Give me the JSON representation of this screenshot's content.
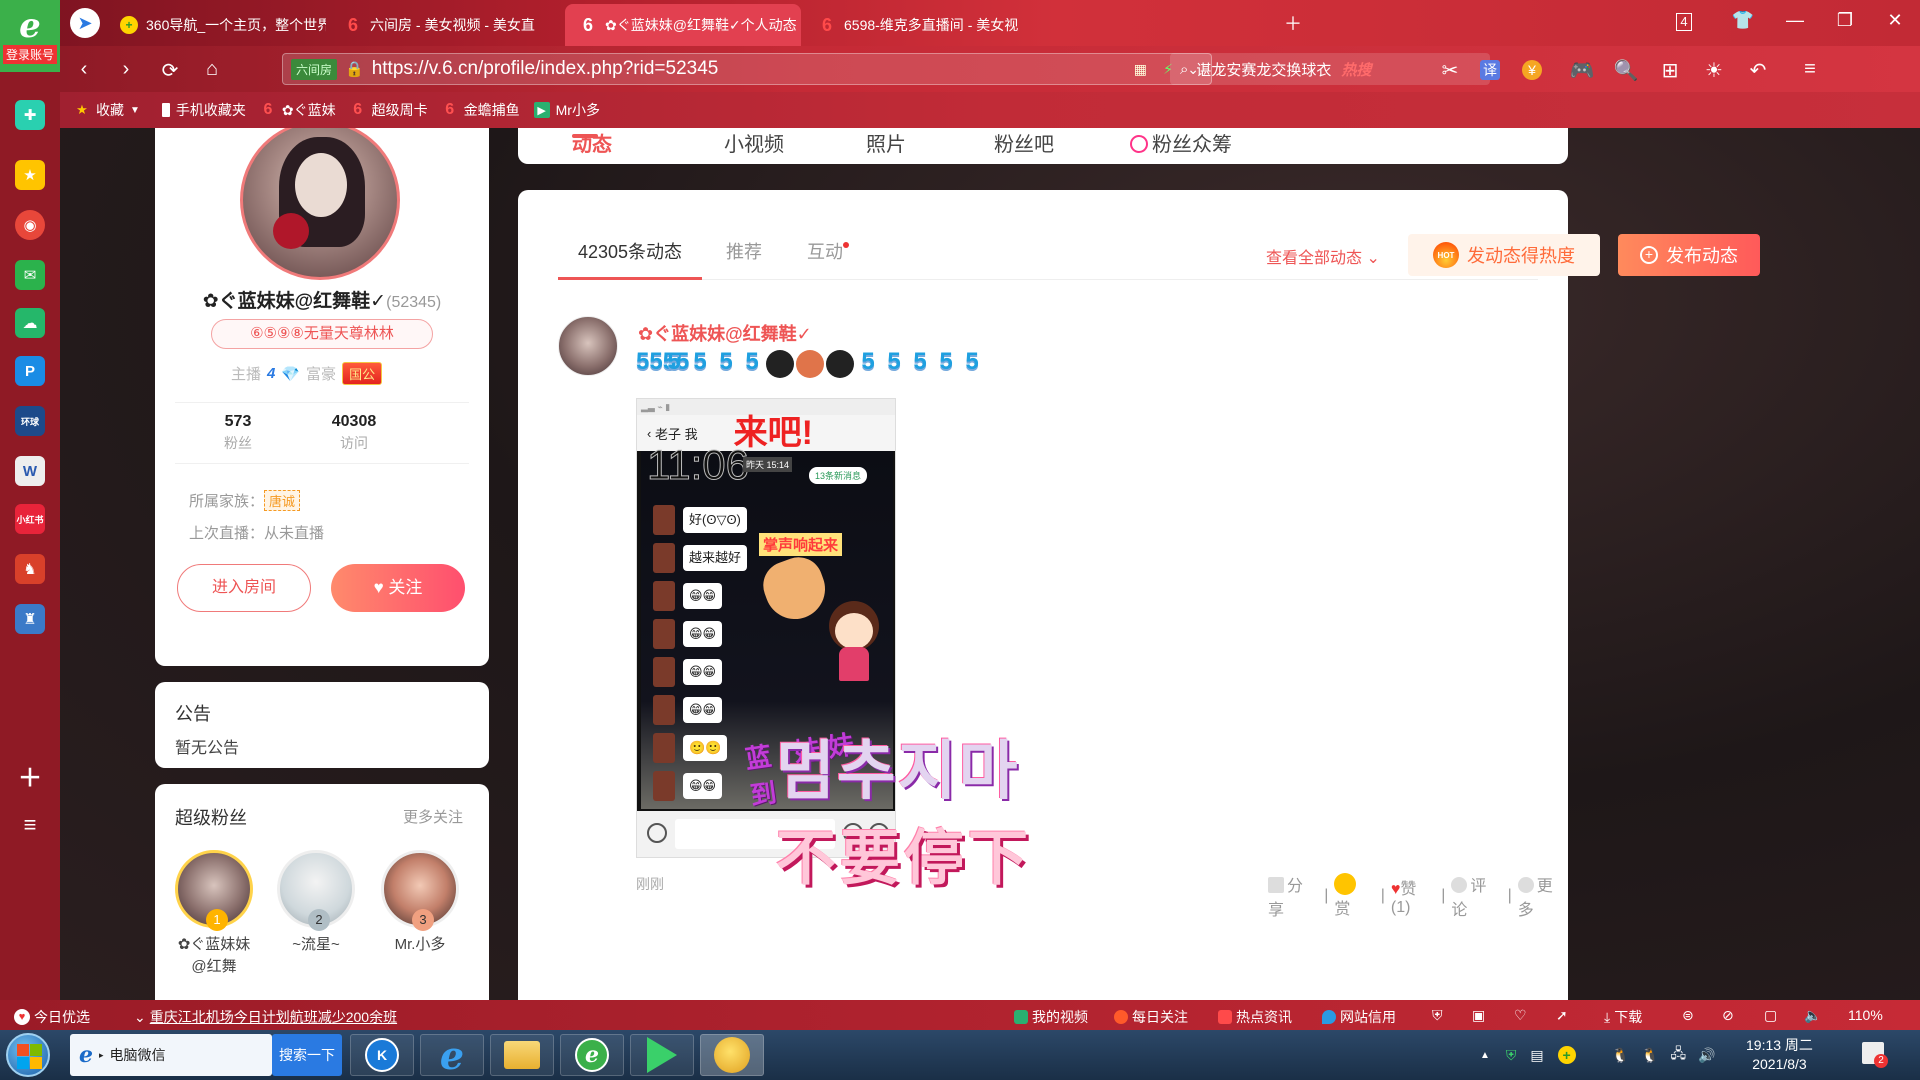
{
  "browser": {
    "login_label": "登录账号",
    "tabs": [
      {
        "title": "360导航_一个主页，整个世界",
        "active": false
      },
      {
        "title": "六间房 - 美女视频 - 美女直",
        "active": false
      },
      {
        "title": "✿ぐ蓝妹妹@红舞鞋✓个人动态",
        "active": true
      },
      {
        "title": "6598-维克多直播间 - 美女视",
        "active": false
      }
    ],
    "tab_count": "4",
    "url": "https://v.6.cn/profile/index.php?rid=52345",
    "url_tag": "六间房",
    "search_text": "谌龙安赛龙交换球衣",
    "search_hot": "热搜",
    "zoom": "110%"
  },
  "bookmarks": [
    {
      "label": "收藏",
      "icon": "star-icon"
    },
    {
      "label": "手机收藏夹",
      "icon": "phone-icon"
    },
    {
      "label": "✿ぐ蓝妹",
      "icon": "six-icon"
    },
    {
      "label": "超级周卡",
      "icon": "six-icon"
    },
    {
      "label": "金蟾捕鱼",
      "icon": "six-icon"
    },
    {
      "label": "Mr小多",
      "icon": "mr-icon"
    }
  ],
  "top_nav": {
    "items": [
      "动态",
      "小视频",
      "照片",
      "粉丝吧",
      "粉丝众筹"
    ],
    "active_index": 0
  },
  "profile": {
    "name": "✿ぐ蓝妹妹@红舞鞋✓",
    "rid": "(52345)",
    "badge": "⑥⑤⑨⑧无量天尊林林",
    "anchor_label": "主播",
    "anchor_level": "4",
    "rich_label": "富豪",
    "rich_badge": "国公",
    "fans_count": "573",
    "fans_label": "粉丝",
    "visits_count": "40308",
    "visits_label": "访问",
    "family_label": "所属家族：",
    "family_value": "唐诚",
    "last_live_label": "上次直播：从未直播",
    "enter_room": "进入房间",
    "follow": "关注"
  },
  "notice": {
    "title": "公告",
    "text": "暂无公告"
  },
  "super_fans": {
    "title": "超级粉丝",
    "more": "更多关注",
    "items": [
      {
        "rank": "1",
        "name": "✿ぐ蓝妹妹@红舞"
      },
      {
        "rank": "2",
        "name": "~流星~"
      },
      {
        "rank": "3",
        "name": "Mr.小多"
      }
    ]
  },
  "feed": {
    "tabs": [
      "42305条动态",
      "推荐",
      "互动"
    ],
    "view_all": "查看全部动态",
    "heat_button": "发动态得热度",
    "hot_label": "HOT",
    "post_button": "发布动态",
    "post": {
      "author": "✿ぐ蓝妹妹@红舞鞋✓",
      "emoji_text": "5555",
      "time": "刚刚",
      "actions": [
        "分享",
        "赏",
        "赞(1)",
        "评论",
        "更多"
      ],
      "image": {
        "header_name": "老子 我",
        "come": "来吧!",
        "time": "11:06",
        "yesterday": "昨天 15:14",
        "new_msgs": "13条新消息",
        "msgs": [
          "好(ʘ▽ʘ)",
          "越来越好",
          "😁😁",
          "😁😁",
          "😁😁",
          "😁😁",
          "🙂🙂",
          "😁😁",
          "🎆"
        ],
        "clap_text": "掌声响起来",
        "arrive_text": "蓝 妹妹 到",
        "overlay_korean": "멈추지마",
        "overlay_cn": "不要停下"
      }
    }
  },
  "statusbar": {
    "left": "今日优选",
    "news": "重庆江北机场今日计划航班减少200余班",
    "items": [
      "我的视频",
      "每日关注",
      "热点资讯",
      "网站信用",
      "下载"
    ]
  },
  "taskbar": {
    "ie_label": "电脑微信",
    "search_btn": "搜索一下",
    "time": "19:13 周二",
    "date": "2021/8/3",
    "notif": "2"
  }
}
